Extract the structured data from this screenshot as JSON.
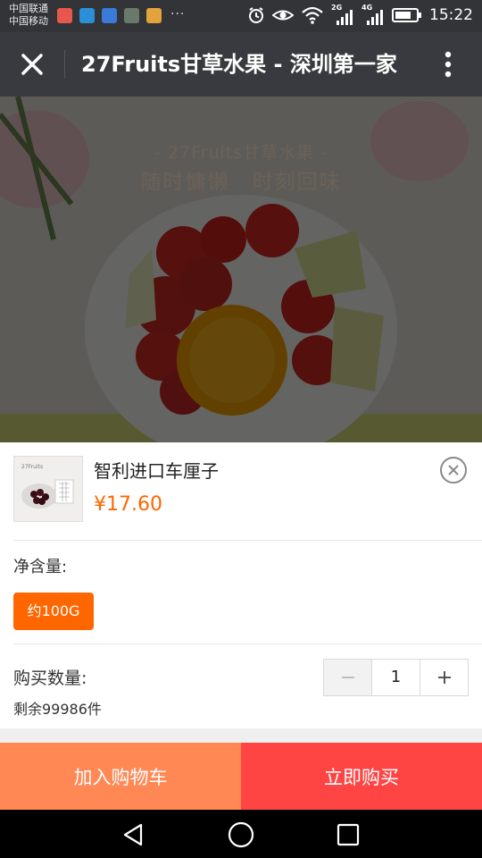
{
  "status_bar": {
    "carrier_1": "中国联通",
    "carrier_2": "中国移动",
    "more": "···",
    "network_1": "2G",
    "network_2": "4G",
    "time": "15:22"
  },
  "title_bar": {
    "title": "27Fruits甘草水果 - 深圳第一家",
    "close_icon": "close-icon",
    "more_icon": "more-vertical-icon"
  },
  "banner": {
    "subtitle": "- 27Fruits甘草水果 -",
    "slogan": "随时慵懒　时刻回味"
  },
  "product": {
    "name": "智利进口车厘子",
    "price": "¥17.60",
    "thumbnail_text": "27Fruits"
  },
  "spec": {
    "label": "净含量:",
    "options": [
      "约100G"
    ],
    "selected": "约100G"
  },
  "quantity": {
    "label": "购买数量:",
    "value": "1",
    "stock": "剩余99986件"
  },
  "actions": {
    "add_to_cart": "加入购物车",
    "buy_now": "立即购买"
  },
  "colors": {
    "accent": "#ff6600",
    "cart_button": "#ff8855",
    "buy_button": "#ff4444",
    "title_bar": "#393a3f"
  }
}
